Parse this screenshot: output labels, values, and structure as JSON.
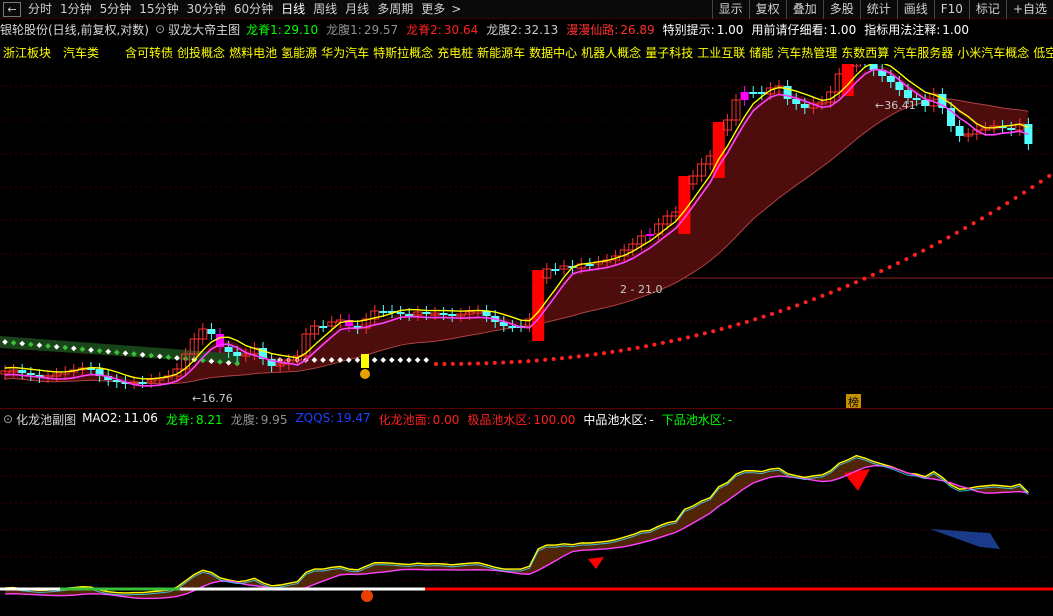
{
  "toolbar": {
    "back_icon": "←",
    "periods": [
      "分时",
      "1分钟",
      "5分钟",
      "15分钟",
      "30分钟",
      "60分钟",
      "日线",
      "周线",
      "月线",
      "多周期",
      "更多"
    ],
    "active_period": "日线",
    "more_icon": "chevron-right-icon",
    "right_buttons": [
      "显示",
      "复权",
      "叠加",
      "多股",
      "统计",
      "画线",
      "F10",
      "标记",
      "+自选"
    ]
  },
  "main_header": {
    "stock": "银轮股份(日线,前复权,对数)",
    "indicator": "驭龙大帝主图",
    "items": [
      {
        "label": "龙脊1:",
        "value": "29.10",
        "color": "#00ff00"
      },
      {
        "label": "龙腹1:",
        "value": "29.57",
        "color": "#909090"
      },
      {
        "label": "龙脊2:",
        "value": "30.64",
        "color": "#ff2020"
      },
      {
        "label": "龙腹2:",
        "value": "32.13",
        "color": "#c8c8c8"
      },
      {
        "label": "漫漫仙路:",
        "value": "26.89",
        "color": "#ff3030"
      },
      {
        "label": "特别提示:",
        "value": "1.00",
        "color": "#ffffff"
      },
      {
        "label": "用前请仔细看:",
        "value": "1.00",
        "color": "#ffffff"
      },
      {
        "label": "指标用法注释:",
        "value": "1.00",
        "color": "#ffffff"
      }
    ]
  },
  "concepts": [
    "浙江板块",
    "汽车类",
    "含可转债",
    "创投概念",
    "燃料电池",
    "氢能源",
    "华为汽车",
    "特斯拉概念",
    "充电桩",
    "新能源车",
    "数据中心",
    "机器人概念",
    "量子科技",
    "工业互联",
    "储能",
    "汽车热管理",
    "东数西算",
    "汽车服务器",
    "小米汽车概念",
    "低空经"
  ],
  "annotations": {
    "low_price": "16.76",
    "high_price": "36.41",
    "mid_level": "2 - 21.0",
    "badge": "榜"
  },
  "sub_header": {
    "indicator": "化龙池副图",
    "items": [
      {
        "label": "MAO2:",
        "value": "11.06",
        "color": "#ffffff"
      },
      {
        "label": "龙脊:",
        "value": "8.21",
        "color": "#00ff00"
      },
      {
        "label": "龙腹:",
        "value": "9.95",
        "color": "#909090"
      },
      {
        "label": "ZQQS:",
        "value": "19.47",
        "color": "#2040ff"
      },
      {
        "label": "化龙池面:",
        "value": "0.00",
        "color": "#ff2020"
      },
      {
        "label": "极品池水区:",
        "value": "100.00",
        "color": "#ff2020"
      },
      {
        "label": "中品池水区:",
        "value": "-",
        "color": "#ffffff"
      },
      {
        "label": "下品池水区:",
        "value": "-",
        "color": "#00ff00"
      }
    ]
  },
  "colors": {
    "up_candle": "#ff3030",
    "down_candle": "#54ffff",
    "signal_candle": "#ff00ff",
    "ribbon_fill": "#5a0f0f",
    "ma_yellow": "#ffff00",
    "ma_magenta": "#ff40ff",
    "dot_red": "#ff2020"
  }
}
